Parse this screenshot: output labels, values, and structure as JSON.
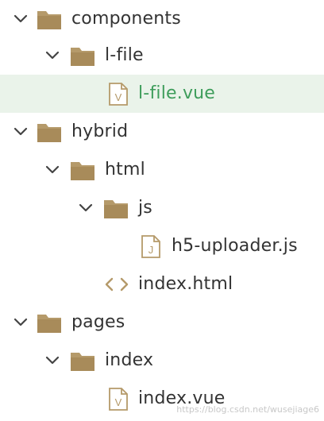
{
  "tree": {
    "items": [
      {
        "label": "components",
        "icon": "folder-icon",
        "expanded": true
      },
      {
        "label": "l-file",
        "icon": "folder-icon",
        "expanded": true
      },
      {
        "label": "l-file.vue",
        "icon": "vue-file-icon",
        "selected": true
      },
      {
        "label": "hybrid",
        "icon": "folder-icon",
        "expanded": true
      },
      {
        "label": "html",
        "icon": "folder-icon",
        "expanded": true
      },
      {
        "label": "js",
        "icon": "folder-icon",
        "expanded": true
      },
      {
        "label": "h5-uploader.js",
        "icon": "js-file-icon"
      },
      {
        "label": "index.html",
        "icon": "html-file-icon"
      },
      {
        "label": "pages",
        "icon": "folder-icon",
        "expanded": true
      },
      {
        "label": "index",
        "icon": "folder-icon",
        "expanded": true
      },
      {
        "label": "index.vue",
        "icon": "vue-file-icon"
      }
    ]
  },
  "watermark": "https://blog.csdn.net/wusejiage6",
  "colors": {
    "folder": "#b59a6a",
    "selected_bg": "#eaf3ea",
    "selected_text": "#3e9d5b",
    "text": "#333333",
    "icon_stroke": "#b59a6a"
  }
}
